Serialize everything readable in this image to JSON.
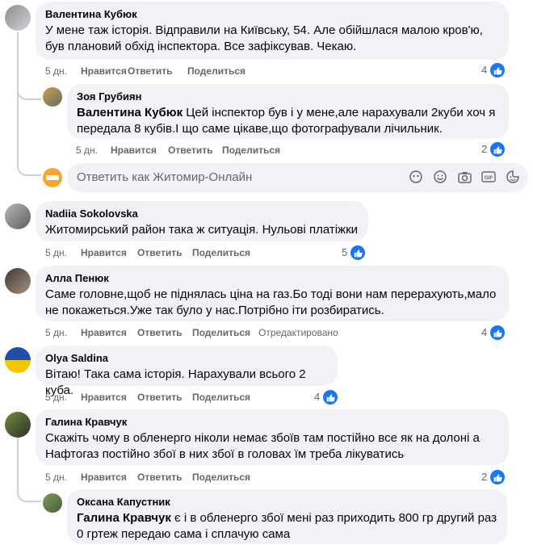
{
  "actions": {
    "like": "Нравится",
    "reply": "Ответить",
    "share": "Поделиться",
    "edited": "Отредактировано"
  },
  "comments": [
    {
      "author": "Валентина Кубюк",
      "text": "У мене таж історія. Відправили на Київську, 54. Але обійшлася малою кров'ю, був плановий обхід інспектора. Все зафіксував. Чекаю.",
      "time": "5 дн.",
      "reactions": "4"
    },
    {
      "author": "Зоя Грубиян",
      "mention": "Валентина Кубюк",
      "text": " Цей інспектор був і у мене,але нарахували 2куби хоч я передала 8 кубів.І що саме цікаве,що фотографували лічильник.",
      "time": "5 дн.",
      "reactions": "2"
    },
    {
      "author": "Nadiia Sokolovska",
      "text": "Житомирський район така ж ситуація. Нульові платіжки",
      "time": "5 дн.",
      "reactions": "5"
    },
    {
      "author": "Алла Пенюк",
      "text": "Саме головне,щоб не піднялась ціна на газ.Бо тоді вони нам перерахують,мало не покажеться.Уже так було у нас.Потрібно іти розбиратись.",
      "time": "5 дн.",
      "reactions": "4"
    },
    {
      "author": "Olya Saldina",
      "text": "Вітаю! Така сама історія. Нарахували всього 2 куба.",
      "time": "5 дн.",
      "reactions": "4"
    },
    {
      "author": "Галина Кравчук",
      "text": "Скажіть чому в обленерго ніколи немає збоїв там постійно все як на долоні а Нафтогаз постійно збої в них збої в головах їм треба лікуватись",
      "time": "5 дн.",
      "reactions": "2"
    },
    {
      "author": "Оксана Капустник",
      "mention": "Галина Кравчук",
      "text": " є і в обленерго збої мені раз приходить 800 гр другий раз 0 гртеж передаю сама і сплачую сама"
    }
  ],
  "reply_box": {
    "placeholder": "Ответить как Житомир-Онлайн"
  },
  "colors": {
    "bubble": "#f0f2f5",
    "like": "#1877f2",
    "meta": "#65676b"
  }
}
